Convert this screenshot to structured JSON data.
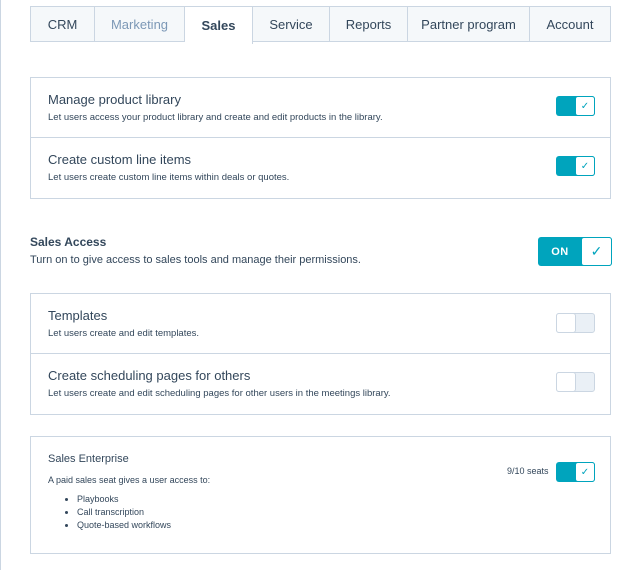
{
  "tabs": [
    {
      "label": "CRM",
      "state": "normal"
    },
    {
      "label": "Marketing",
      "state": "muted"
    },
    {
      "label": "Sales",
      "state": "active"
    },
    {
      "label": "Service",
      "state": "normal"
    },
    {
      "label": "Reports",
      "state": "normal"
    },
    {
      "label": "Partner program",
      "state": "normal"
    },
    {
      "label": "Account",
      "state": "normal"
    }
  ],
  "product_permissions": {
    "manage_library": {
      "title": "Manage product library",
      "desc": "Let users access your product library and create and edit products in the library.",
      "enabled": true
    },
    "custom_line_items": {
      "title": "Create custom line items",
      "desc": "Let users create custom line items within deals or quotes.",
      "enabled": true
    }
  },
  "sales_access": {
    "title": "Sales Access",
    "desc": "Turn on to give access to sales tools and manage their permissions.",
    "toggle_label": "ON",
    "enabled": true
  },
  "sales_permissions": {
    "templates": {
      "title": "Templates",
      "desc": "Let users create and edit templates.",
      "enabled": false
    },
    "scheduling": {
      "title": "Create scheduling pages for others",
      "desc": "Let users create and edit scheduling pages for other users in the meetings library.",
      "enabled": false
    }
  },
  "enterprise": {
    "title": "Sales Enterprise",
    "desc": "A paid sales seat gives a user access to:",
    "features": [
      "Playbooks",
      "Call transcription",
      "Quote-based workflows"
    ],
    "seats": "9/10 seats",
    "enabled": true
  },
  "colors": {
    "accent": "#00a4bd",
    "border": "#cbd6e2",
    "text": "#33475b",
    "muted": "#7c98b6"
  }
}
